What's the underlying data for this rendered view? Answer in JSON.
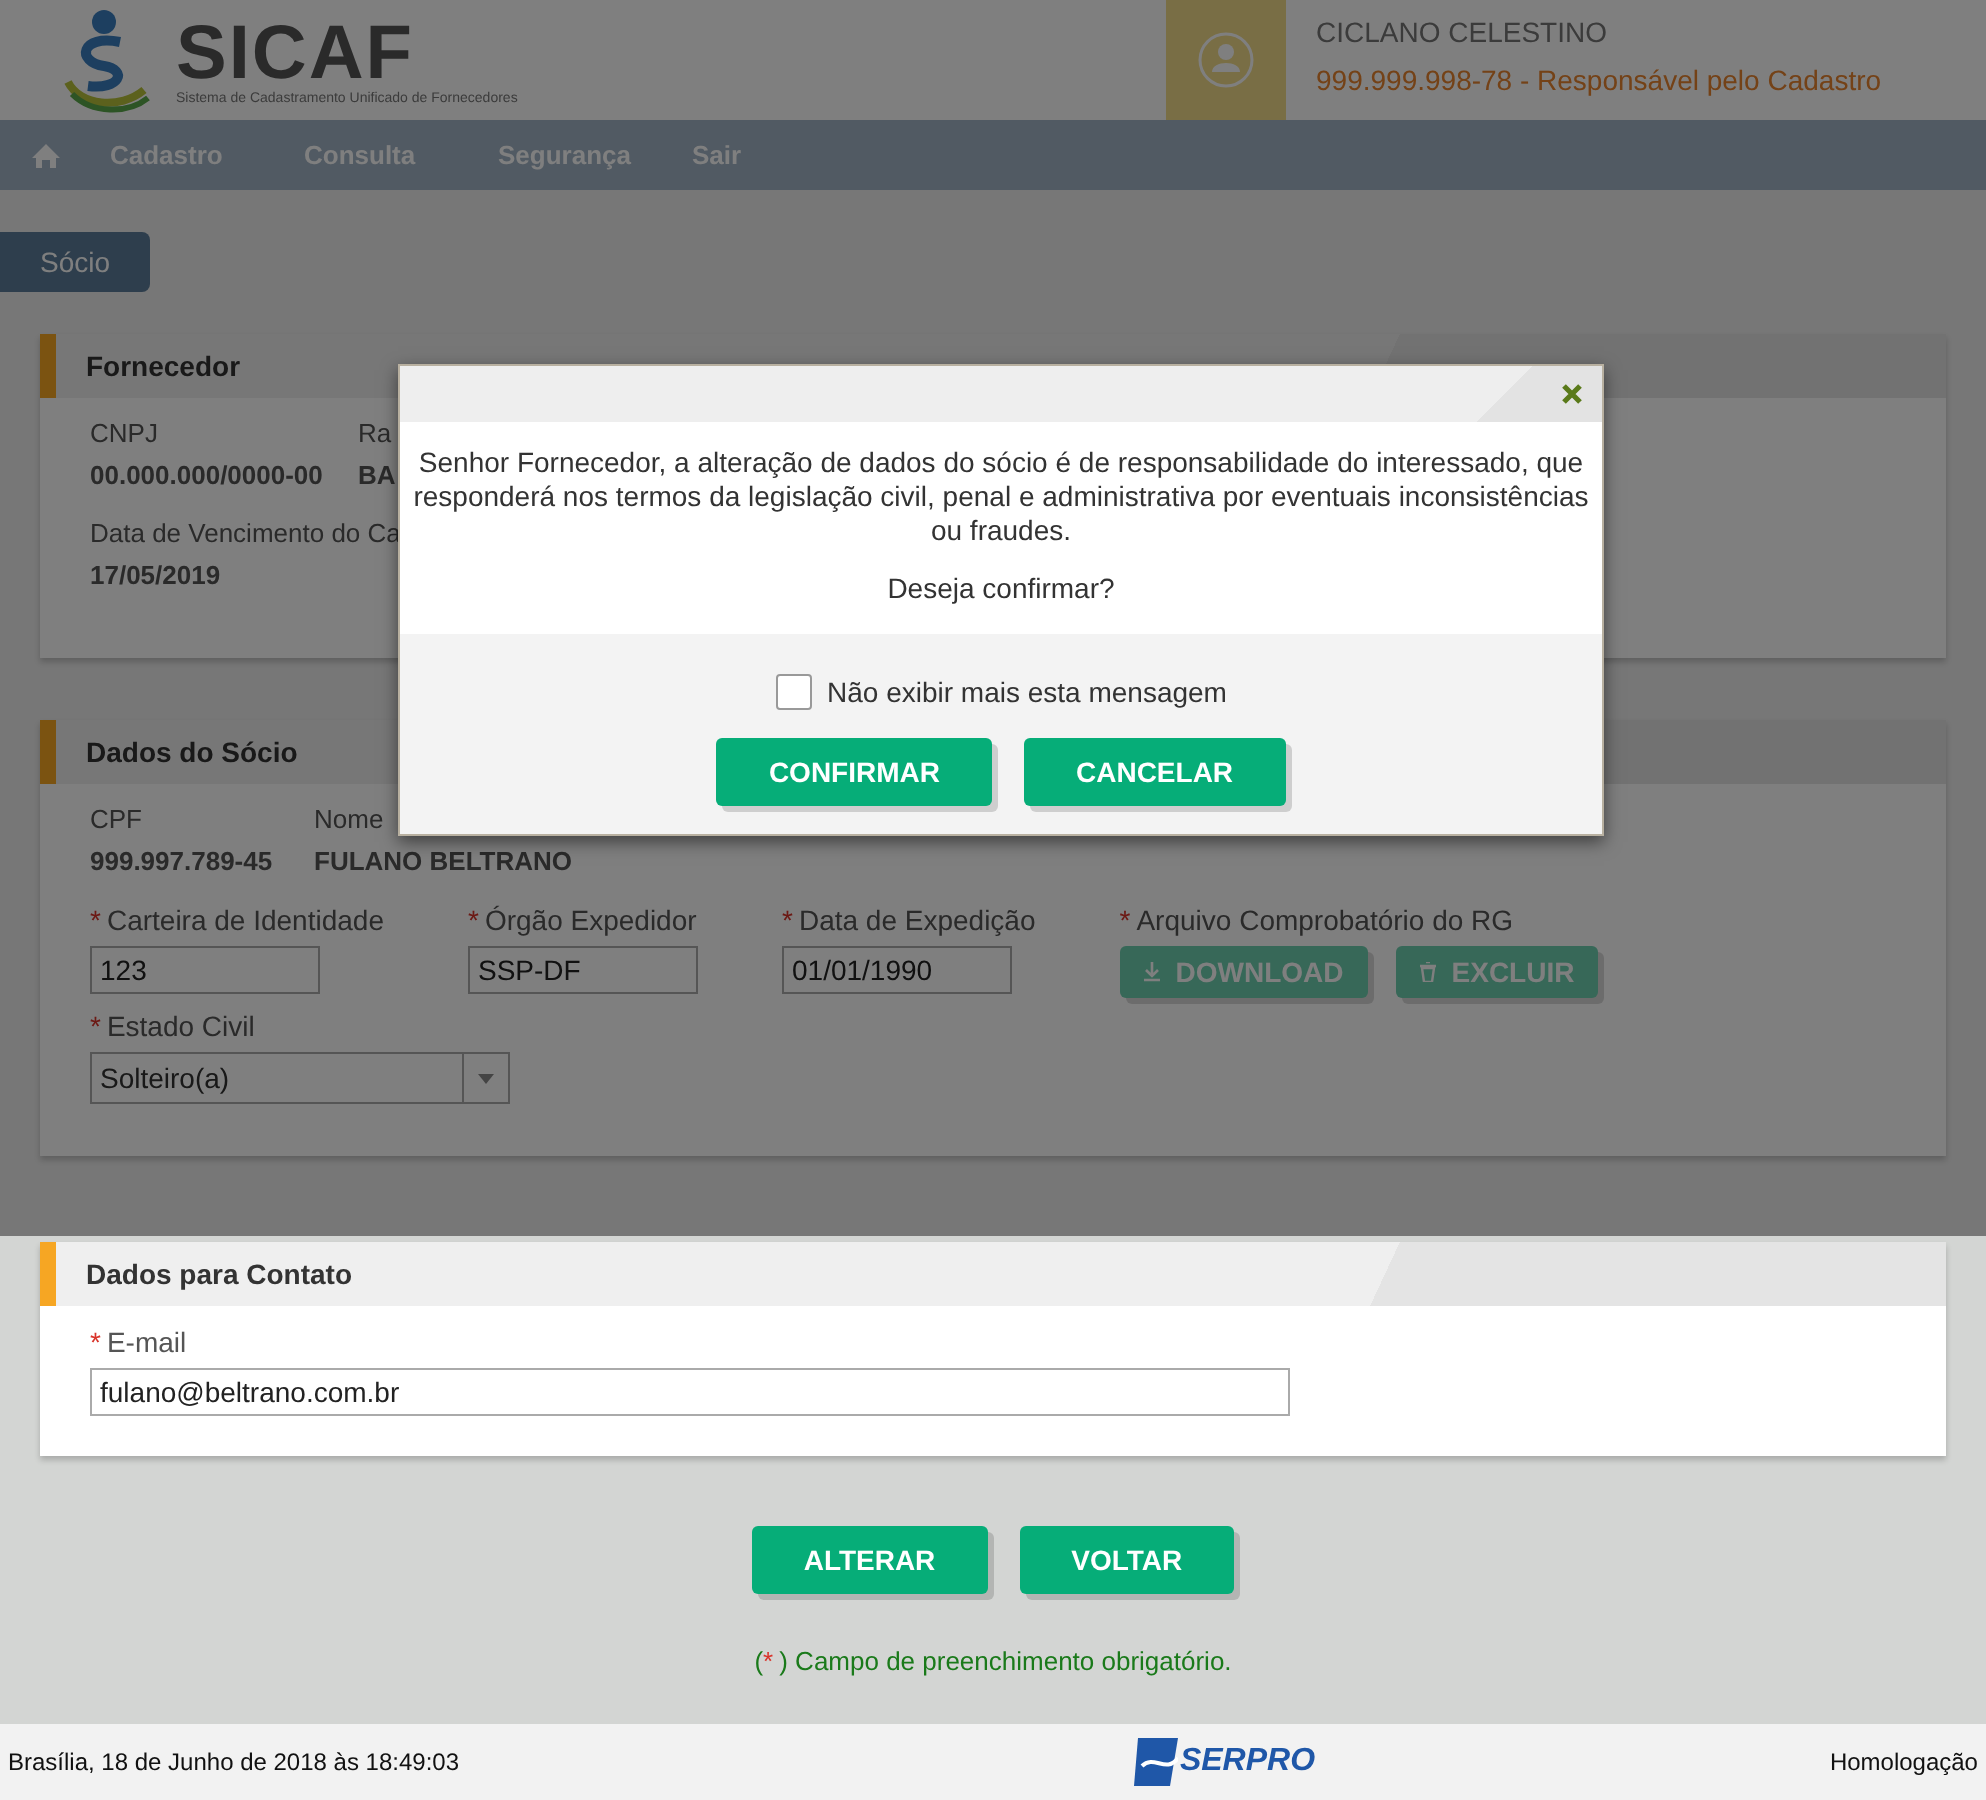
{
  "header": {
    "logo_title": "SICAF",
    "logo_subtitle": "Sistema de Cadastramento Unificado de Fornecedores",
    "user_name": "CICLANO CELESTINO",
    "user_cpf": "999.999.998-78",
    "user_role": "- Responsável pelo Cadastro"
  },
  "nav": [
    "Cadastro",
    "Consulta",
    "Segurança",
    "Sair"
  ],
  "page_tab": "Sócio",
  "required_mark": "*",
  "fornecedor": {
    "title": "Fornecedor",
    "rows": [
      [
        {
          "label": "CNPJ",
          "value": "00.000.000/0000-00"
        },
        {
          "label": "Ra",
          "value": "BA"
        }
      ],
      [
        {
          "label": "Data de Vencimento do Ca",
          "value": "17/05/2019"
        }
      ]
    ]
  },
  "socio": {
    "title": "Dados do Sócio",
    "info": [
      {
        "label": "CPF",
        "value": "999.997.789-45"
      },
      {
        "label": "Nome",
        "value": "FULANO BELTRANO"
      }
    ],
    "fields": [
      [
        {
          "kind": "input",
          "label": "Carteira de Identidade",
          "required": true,
          "value": "123"
        },
        {
          "kind": "input",
          "label": "Órgão Expedidor",
          "required": true,
          "value": "SSP-DF"
        },
        {
          "kind": "input",
          "label": "Data de Expedição",
          "required": true,
          "value": "01/01/1990"
        },
        {
          "kind": "files",
          "label": "Arquivo Comprobatório do RG",
          "required": true,
          "buttons": [
            {
              "kind": "download",
              "label": "DOWNLOAD"
            },
            {
              "kind": "delete",
              "label": "EXCLUIR"
            }
          ]
        }
      ],
      [
        {
          "kind": "select",
          "label": "Estado Civil",
          "required": true,
          "value": "Solteiro(a)"
        }
      ]
    ]
  },
  "contato": {
    "title": "Dados para Contato",
    "fields": [
      {
        "kind": "input",
        "label": "E-mail",
        "required": true,
        "value": "fulano@beltrano.com.br"
      }
    ]
  },
  "actions": [
    "ALTERAR",
    "VOLTAR"
  ],
  "note": {
    "before": "(",
    "mark": "*",
    "after": ") Campo de preenchimento obrigatório."
  },
  "footer": {
    "datetime": "Brasília, 18 de Junho de 2018 às 18:49:03",
    "logo": "SERPRO",
    "environment": "Homologação"
  },
  "dialog": {
    "message": "Senhor Fornecedor, a alteração de dados do sócio é de responsabilidade do interessado, que responderá nos termos da legislação civil, penal e administrativa por eventuais inconsistências ou fraudes.",
    "question": "Deseja confirmar?",
    "checkbox": {
      "label": "Não exibir mais esta mensagem",
      "checked": false
    },
    "buttons": [
      "CONFIRMAR",
      "CANCELAR"
    ]
  }
}
